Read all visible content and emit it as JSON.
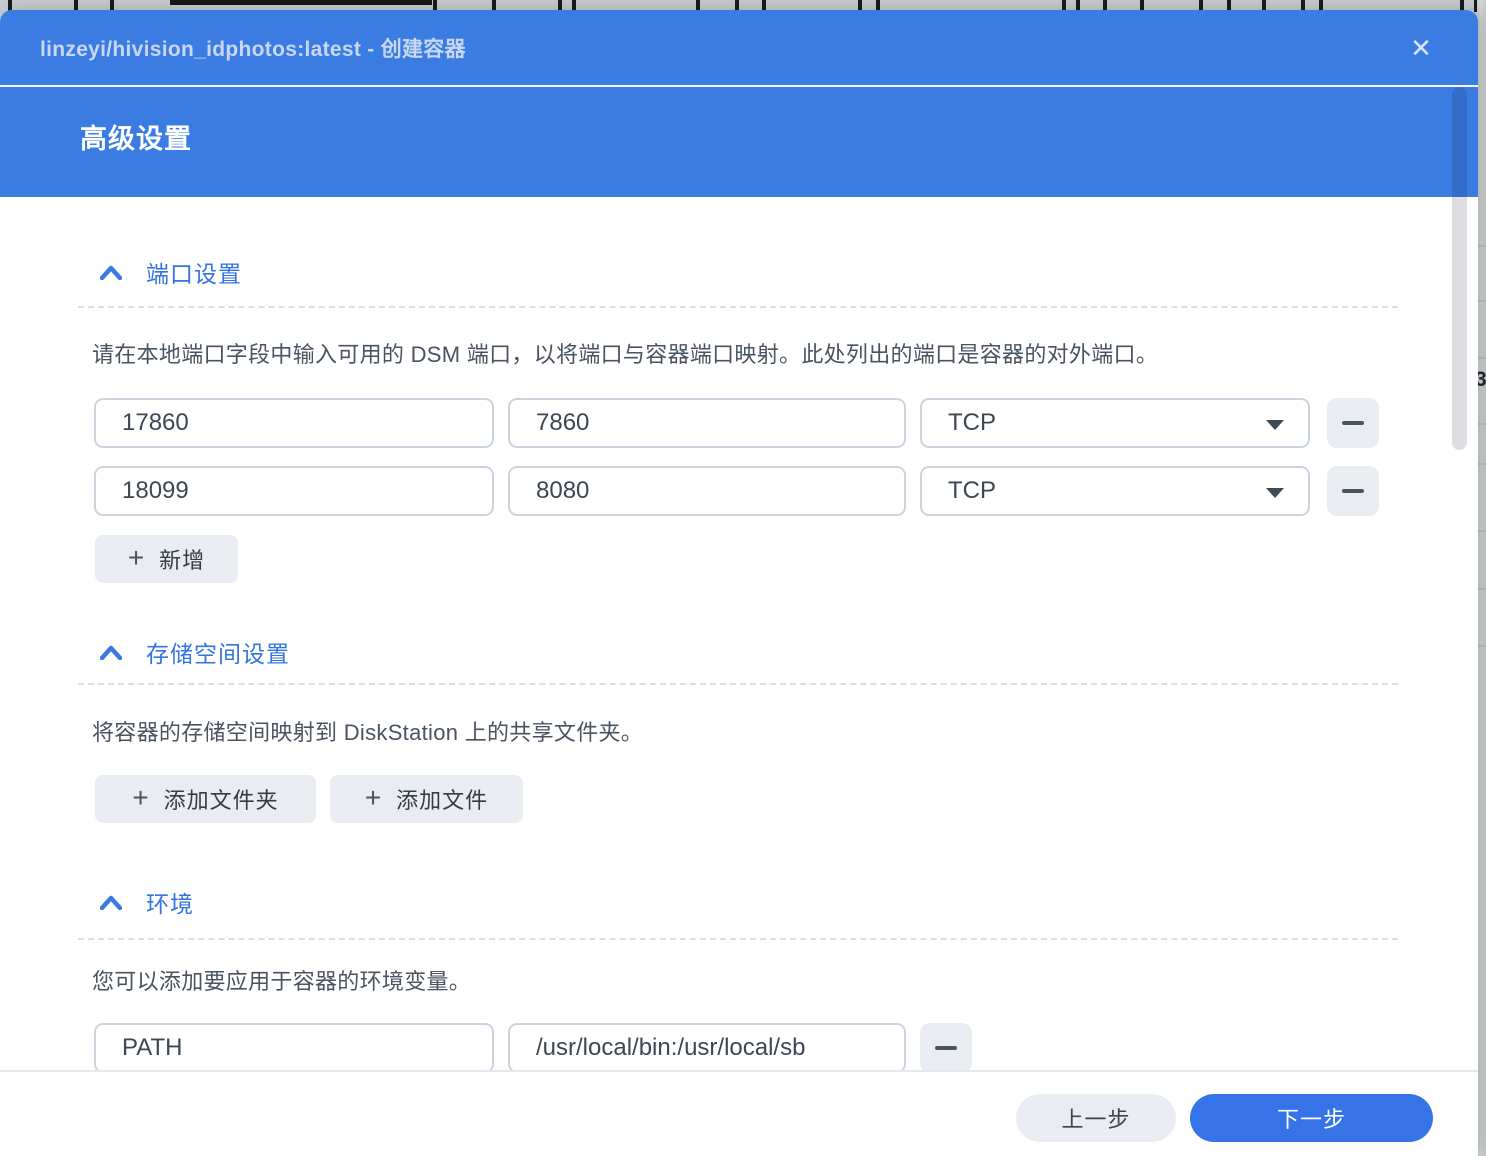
{
  "window": {
    "title": "linzeyi/hivision_idphotos:latest - 创建容器",
    "header": "高级设置"
  },
  "icons": {
    "close": "✕",
    "plus": "+",
    "minus": "minus-bar-shape",
    "chevron_up": "chevron-up-shape",
    "caret_down": "caret-down-triangle"
  },
  "sections": {
    "ports": {
      "title": "端口设置",
      "description": "请在本地端口字段中输入可用的 DSM 端口，以将端口与容器端口映射。此处列出的端口是容器的对外端口。",
      "rows": [
        {
          "local_port": "17860",
          "container_port": "7860",
          "type": "TCP"
        },
        {
          "local_port": "18099",
          "container_port": "8080",
          "type": "TCP"
        }
      ],
      "add_label": "新增"
    },
    "storage": {
      "title": "存储空间设置",
      "description": "将容器的存储空间映射到 DiskStation 上的共享文件夹。",
      "add_folder_label": "添加文件夹",
      "add_file_label": "添加文件"
    },
    "environment": {
      "title": "环境",
      "description": "您可以添加要应用于容器的环境变量。",
      "variables": [
        {
          "name": "PATH",
          "value": "/usr/local/bin:/usr/local/sb"
        }
      ]
    }
  },
  "footer": {
    "back_label": "上一步",
    "next_label": "下一步"
  },
  "background": {
    "partial_text": "3"
  },
  "colors": {
    "primary_blue": "#3b7ce3",
    "section_blue": "#3374e4",
    "next_button_blue": "#3673e6",
    "gray_button": "#e9edf1",
    "input_border": "#ccd4de",
    "body_text": "#4a5360"
  }
}
